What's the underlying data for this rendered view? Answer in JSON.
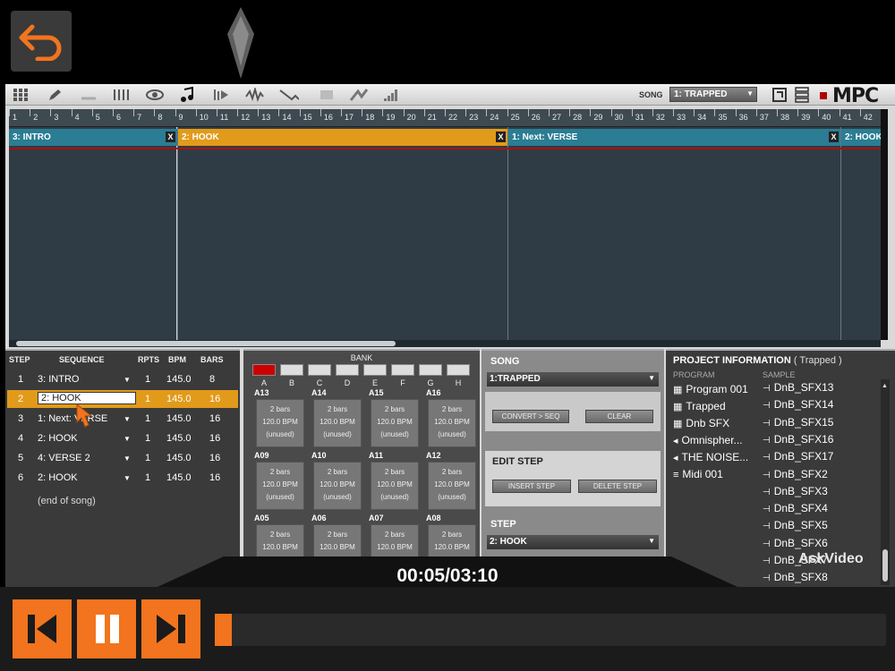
{
  "toolbar": {
    "song_label": "SONG",
    "song_value": "1: TRAPPED",
    "logo": "MPC"
  },
  "ruler": [
    "1",
    "2",
    "3",
    "4",
    "5",
    "6",
    "7",
    "8",
    "9",
    "10",
    "11",
    "12",
    "13",
    "14",
    "15",
    "16",
    "17",
    "18",
    "19",
    "20",
    "21",
    "22",
    "23",
    "24",
    "25",
    "26",
    "27",
    "28",
    "29",
    "30",
    "31",
    "32",
    "33",
    "34",
    "35",
    "36",
    "37",
    "38",
    "39",
    "40",
    "41",
    "42"
  ],
  "tracks": [
    {
      "label": "3: INTRO",
      "color": "#2a7d93"
    },
    {
      "label": "2: HOOK",
      "color": "#e29a1a"
    },
    {
      "label": "1: Next: VERSE",
      "color": "#2a7d93"
    },
    {
      "label": "2: HOOK",
      "color": "#2a7d93"
    }
  ],
  "steps": {
    "headers": {
      "step": "STEP",
      "sequence": "SEQUENCE",
      "rpts": "RPTS",
      "bpm": "BPM",
      "bars": "BARS"
    },
    "rows": [
      {
        "step": "1",
        "sequence": "3: INTRO",
        "rpts": "1",
        "bpm": "145.0",
        "bars": "8"
      },
      {
        "step": "2",
        "sequence": "2: HOOK",
        "rpts": "1",
        "bpm": "145.0",
        "bars": "16"
      },
      {
        "step": "3",
        "sequence": "1: Next: VERSE",
        "rpts": "1",
        "bpm": "145.0",
        "bars": "16"
      },
      {
        "step": "4",
        "sequence": "2: HOOK",
        "rpts": "1",
        "bpm": "145.0",
        "bars": "16"
      },
      {
        "step": "5",
        "sequence": "4: VERSE 2",
        "rpts": "1",
        "bpm": "145.0",
        "bars": "16"
      },
      {
        "step": "6",
        "sequence": "2: HOOK",
        "rpts": "1",
        "bpm": "145.0",
        "bars": "16"
      }
    ],
    "end_text": "(end of song)"
  },
  "bank": {
    "title": "BANK",
    "letters": [
      "A",
      "B",
      "C",
      "D",
      "E",
      "F",
      "G",
      "H"
    ],
    "pad_lines": {
      "bars": "2 bars",
      "bpm": "120.0 BPM",
      "state": "(unused)"
    },
    "rows": [
      [
        "A13",
        "A14",
        "A15",
        "A16"
      ],
      [
        "A09",
        "A10",
        "A11",
        "A12"
      ],
      [
        "A05",
        "A06",
        "A07",
        "A08"
      ]
    ]
  },
  "song_panel": {
    "title": "SONG",
    "song_value": "1:TRAPPED",
    "convert_label": "CONVERT > SEQ",
    "clear_label": "CLEAR",
    "edit_step_title": "EDIT STEP",
    "insert_label": "INSERT STEP",
    "delete_label": "DELETE STEP",
    "step_title": "STEP",
    "step_value": "2: HOOK"
  },
  "project": {
    "title": "PROJECT INFORMATION",
    "subtitle": "( Trapped )",
    "program_head": "PROGRAM",
    "sample_head": "SAMPLE",
    "programs": [
      "Program 001",
      "Trapped",
      "Dnb SFX",
      "Omnispher...",
      "THE NOISE...",
      "Midi 001"
    ],
    "samples": [
      "DnB_SFX13",
      "DnB_SFX14",
      "DnB_SFX15",
      "DnB_SFX16",
      "DnB_SFX17",
      "DnB_SFX2",
      "DnB_SFX3",
      "DnB_SFX4",
      "DnB_SFX5",
      "DnB_SFX6",
      "DnB_SFX7",
      "DnB_SFX8"
    ]
  },
  "player": {
    "timecode": "00:05/03:10",
    "watermark": "AskVideo",
    "progress": 0.026,
    "accent": "#f2741e"
  }
}
